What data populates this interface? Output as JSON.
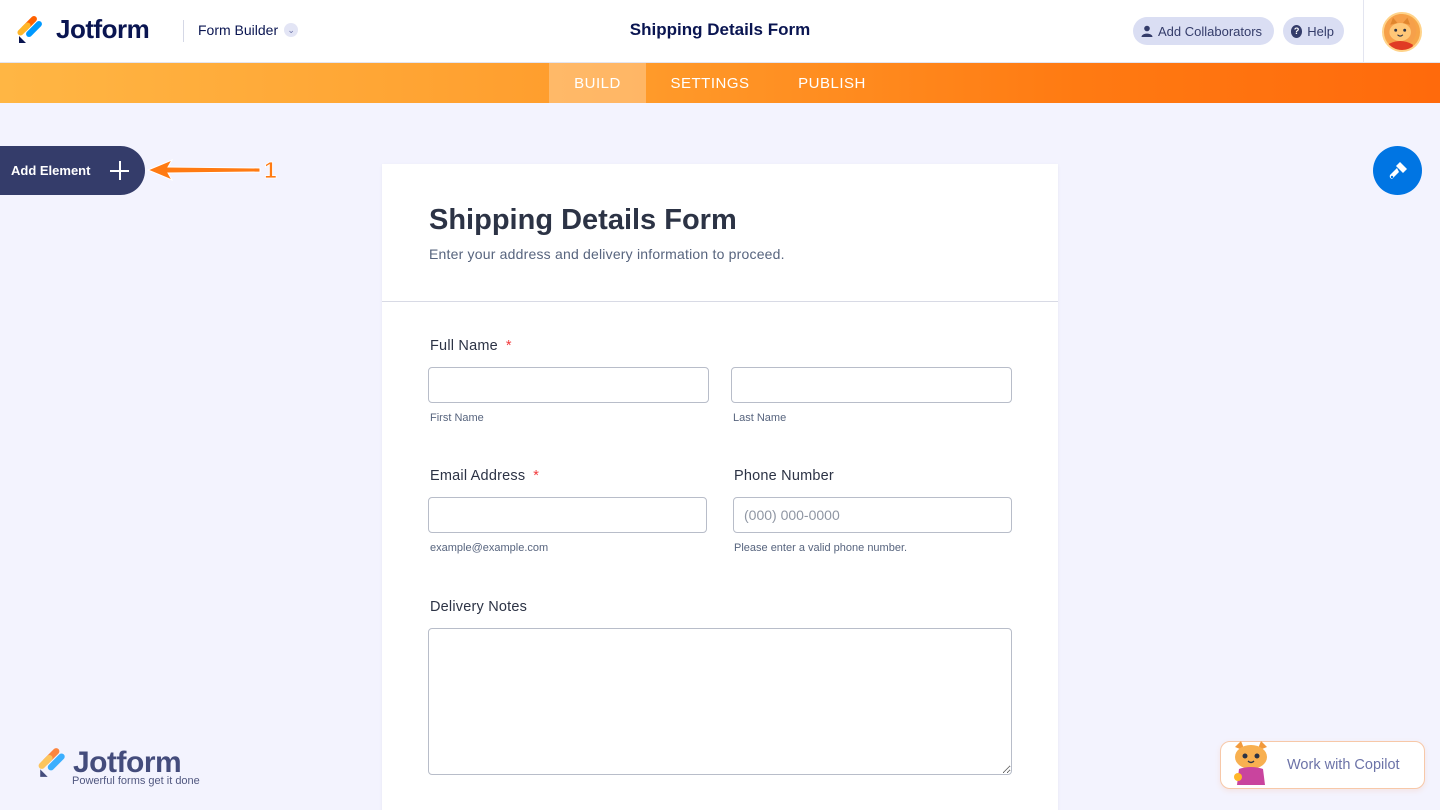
{
  "header": {
    "logo_text": "Jotform",
    "form_builder_label": "Form Builder",
    "title": "Shipping Details Form",
    "add_collaborators_label": "Add Collaborators",
    "help_label": "Help"
  },
  "nav": {
    "tabs": [
      {
        "label": "BUILD",
        "active": true
      },
      {
        "label": "SETTINGS",
        "active": false
      },
      {
        "label": "PUBLISH",
        "active": false
      }
    ]
  },
  "sidebar": {
    "add_element_label": "Add Element",
    "annotation_number": "1"
  },
  "form": {
    "title": "Shipping Details Form",
    "subtitle": "Enter your address and delivery information to proceed.",
    "fields": {
      "full_name": {
        "label": "Full Name",
        "required_mark": "*",
        "first_value": "",
        "last_value": "",
        "first_sublabel": "First Name",
        "last_sublabel": "Last Name"
      },
      "email": {
        "label": "Email Address",
        "required_mark": "*",
        "value": "",
        "sublabel": "example@example.com"
      },
      "phone": {
        "label": "Phone Number",
        "placeholder": "(000) 000-0000",
        "sublabel": "Please enter a valid phone number."
      },
      "notes": {
        "label": "Delivery Notes",
        "value": ""
      }
    }
  },
  "footer": {
    "brand_text": "Jotform",
    "brand_tagline": "Powerful forms get it done",
    "copilot_label": "Work with Copilot"
  },
  "colors": {
    "navy": "#0a1551",
    "orange_start": "#ffb644",
    "orange_end": "#ff6a0c",
    "blue_accent": "#0075e3",
    "required_red": "#f23a3c",
    "annotation_orange": "#ff7a12"
  },
  "icons": {
    "logo": "jotform-logo-icon",
    "chevron": "chevron-down-icon",
    "collaborators": "person-icon",
    "help": "question-icon",
    "add": "plus-icon",
    "design": "paint-roller-icon",
    "copilot": "copilot-cat-icon"
  }
}
